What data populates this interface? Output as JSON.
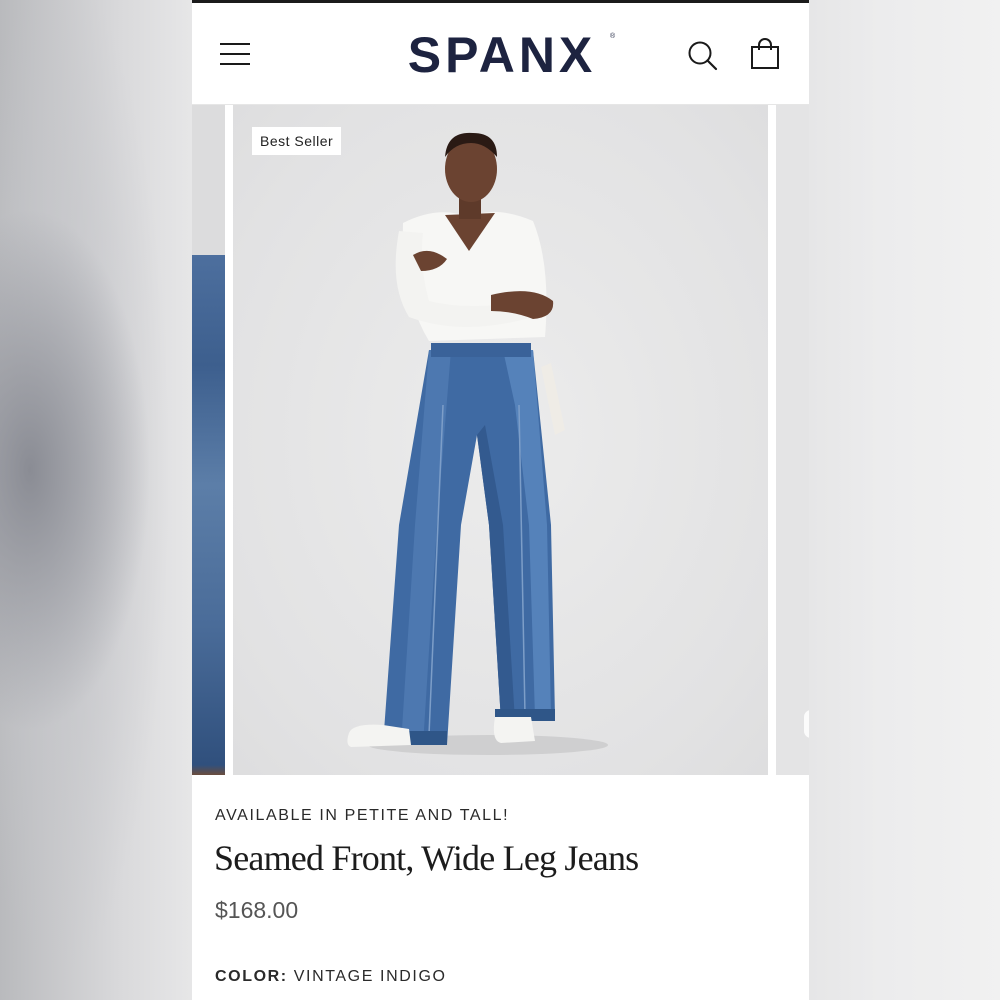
{
  "header": {
    "brand": "SPANX",
    "brand_mark": "®",
    "icons": [
      "menu-icon",
      "search-icon",
      "bag-icon"
    ]
  },
  "carousel": {
    "badge": "Best Seller"
  },
  "product": {
    "eyebrow": "AVAILABLE IN PETITE AND TALL!",
    "title": "Seamed Front, Wide Leg Jeans",
    "price": "$168.00",
    "color_label": "COLOR:",
    "color_value": "VINTAGE INDIGO"
  },
  "colors": {
    "brand_navy": "#1d2340",
    "denim": "#3f6aa3",
    "page_bg": "#ffffff"
  }
}
